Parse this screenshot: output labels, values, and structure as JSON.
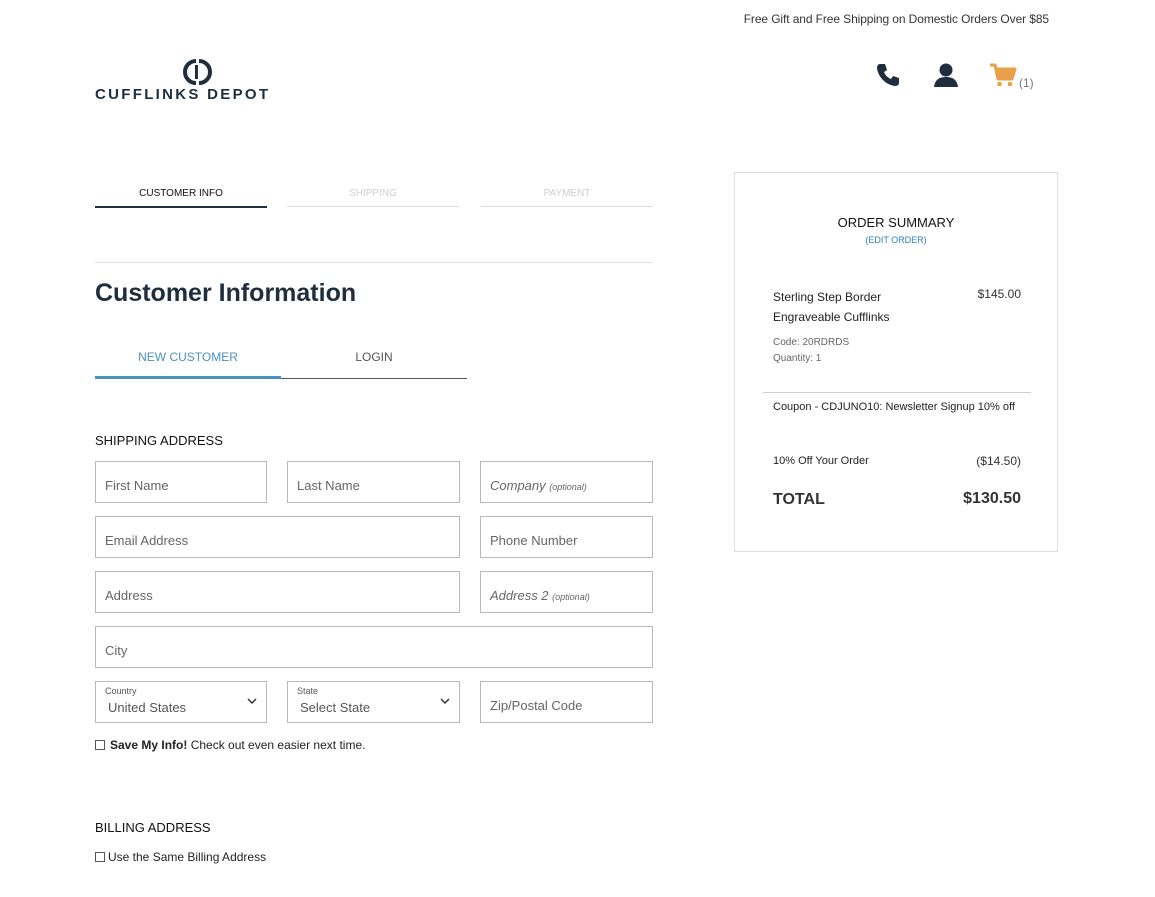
{
  "header": {
    "promo": "Free Gift and Free Shipping on Domestic Orders Over $85",
    "logo_text": "CUFFLINKS DEPOT",
    "icons": [
      "phone-icon",
      "user-icon",
      "cart-icon"
    ],
    "cart_count": "(1)",
    "colors": {
      "brand_dark": "#1f2d3d",
      "cart": "#e8a04a",
      "accent_blue": "#4a90c2"
    }
  },
  "steps": [
    {
      "label": "CUSTOMER INFO",
      "active": true
    },
    {
      "label": "SHIPPING",
      "active": false
    },
    {
      "label": "PAYMENT",
      "active": false
    }
  ],
  "main": {
    "title": "Customer Information",
    "tabs": [
      {
        "label": "NEW CUSTOMER",
        "active": true
      },
      {
        "label": "LOGIN",
        "active": false
      }
    ],
    "shipping_title": "SHIPPING ADDRESS",
    "fields": {
      "first_name": "First Name",
      "last_name": "Last Name",
      "company": "Company",
      "company_note": "(optional)",
      "email": "Email Address",
      "phone": "Phone Number",
      "address": "Address",
      "address2": "Address 2",
      "address2_note": "(optional)",
      "city": "City",
      "country_label": "Country",
      "country_value": "United States",
      "state_label": "State",
      "state_value": "Select State",
      "zip": "Zip/Postal Code"
    },
    "save_info_bold": "Save My Info!",
    "save_info_text": " Check out even easier next time.",
    "billing_title": "BILLING ADDRESS",
    "same_billing": "Use the Same Billing Address"
  },
  "summary": {
    "title": "ORDER SUMMARY",
    "edit": "(EDIT ORDER)",
    "item_name": "Sterling Step Border Engraveable Cufflinks",
    "item_price": "$145.00",
    "item_code": "Code: 20RDRDS",
    "item_qty": "Quantity: 1",
    "coupon": "Coupon - CDJUNO10: Newsletter Signup 10% off",
    "discount_label": "10% Off Your Order",
    "discount_value": "($14.50)",
    "total_label": "TOTAL",
    "total_value": "$130.50"
  }
}
